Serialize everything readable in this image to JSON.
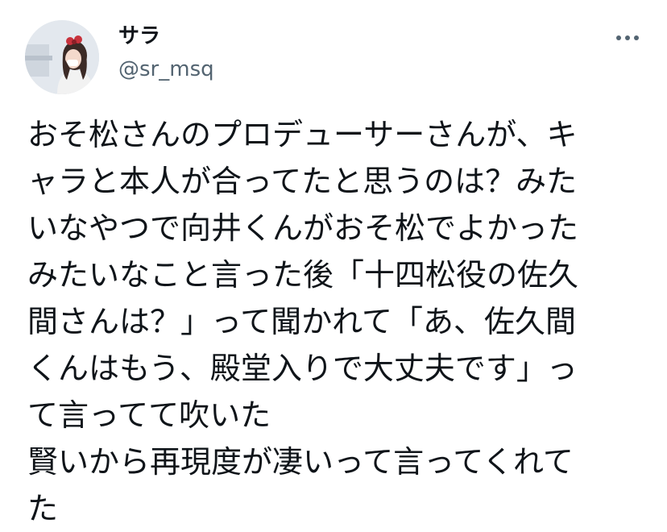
{
  "author": {
    "display_name": "サラ",
    "handle": "@sr_msq",
    "avatar_icon": "profile-photo"
  },
  "more_icon": "more-horizontal-icon",
  "tweet": {
    "lines": [
      "おそ松さんのプロデューサーさんが、キ",
      "ャラと本人が合ってたと思うのは？みた",
      "いなやつで向井くんがおそ松でよかった",
      "みたいなこと言った後「十四松役の佐久",
      "間さんは？」って聞かれて「あ、佐久間",
      "くんはもう、殿堂入りで大丈夫です」っ",
      "て言ってて吹いた",
      "賢いから再現度が凄いって言ってくれて",
      "た"
    ]
  },
  "colors": {
    "text": "#0f1419",
    "secondary": "#536471",
    "background": "#ffffff"
  }
}
